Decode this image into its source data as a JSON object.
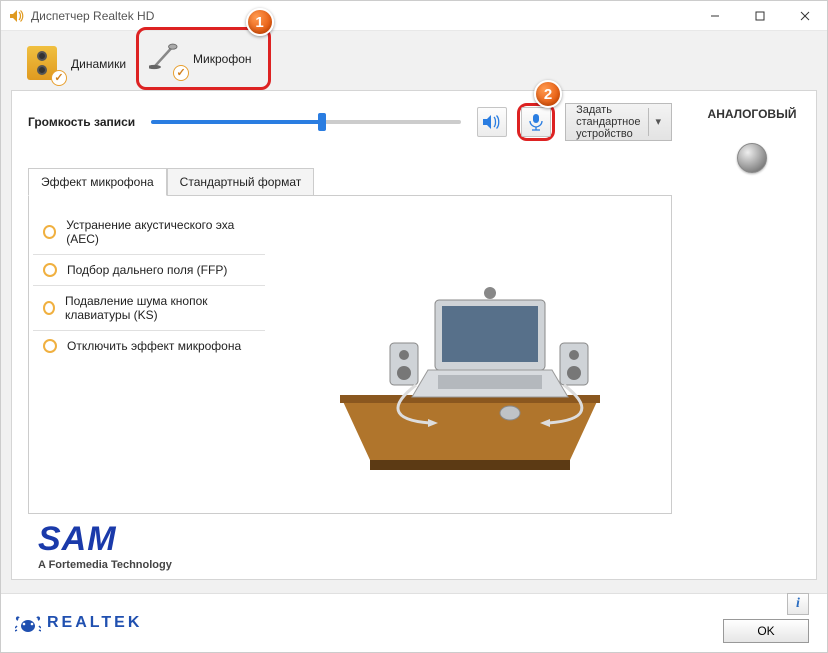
{
  "window": {
    "title": "Диспетчер Realtek HD"
  },
  "deviceTabs": {
    "speakers": "Динамики",
    "microphone": "Микрофон"
  },
  "callouts": {
    "one": "1",
    "two": "2"
  },
  "recording": {
    "label": "Громкость записи",
    "sliderPercent": 55,
    "defaultDevice": "Задать\nстандартное\nустройство"
  },
  "subtabs": {
    "effects": "Эффект микрофона",
    "format": "Стандартный формат"
  },
  "effects": [
    {
      "label": "Устранение акустического эха (AEC)"
    },
    {
      "label": "Подбор дальнего поля (FFP)"
    },
    {
      "label": "Подавление шума кнопок клавиатуры (KS)"
    },
    {
      "label": "Отключить эффект микрофона"
    }
  ],
  "sidebar": {
    "analog": "АНАЛОГОВЫЙ"
  },
  "logos": {
    "sam": "SAM",
    "samSub": "A Fortemedia Technology",
    "realtek": "REALTEK"
  },
  "footer": {
    "ok": "OK"
  }
}
